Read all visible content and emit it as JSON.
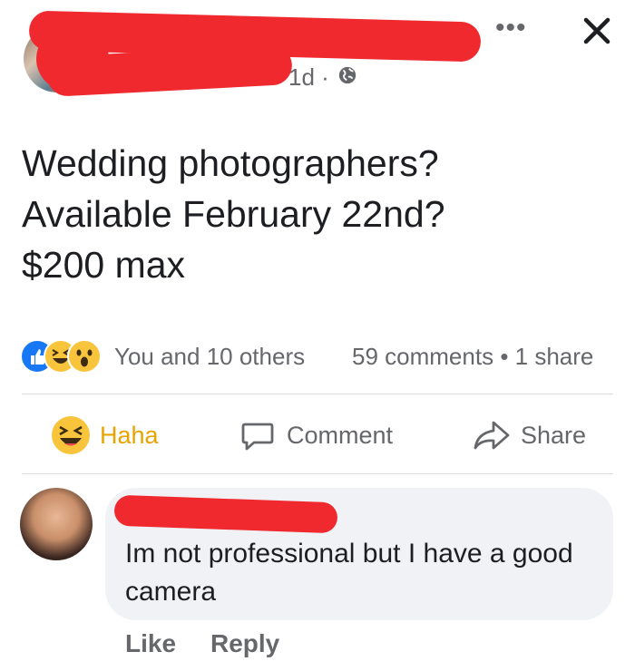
{
  "post": {
    "time": "1d",
    "separator": "·",
    "text": "Wedding photographers?\nAvailable February 22nd?\n$200 max"
  },
  "header_icons": [
    "more-options-icon",
    "close-icon",
    "globe-icon"
  ],
  "reactions": {
    "icons": [
      "like-reaction-icon",
      "haha-reaction-icon",
      "wow-reaction-icon"
    ],
    "summary": "You and 10 others",
    "comments": "59 comments",
    "dot": "•",
    "shares": "1 share"
  },
  "actions": {
    "haha": "Haha",
    "comment": "Comment",
    "share": "Share"
  },
  "comment": {
    "text": "Im not professional but I have a good camera",
    "like": "Like",
    "reply": "Reply"
  },
  "colors": {
    "redaction": "#f0292f",
    "haha_active": "#e6a400",
    "like_blue": "#1877f2",
    "muted_text": "#65676b",
    "bubble": "#f0f2f5"
  }
}
